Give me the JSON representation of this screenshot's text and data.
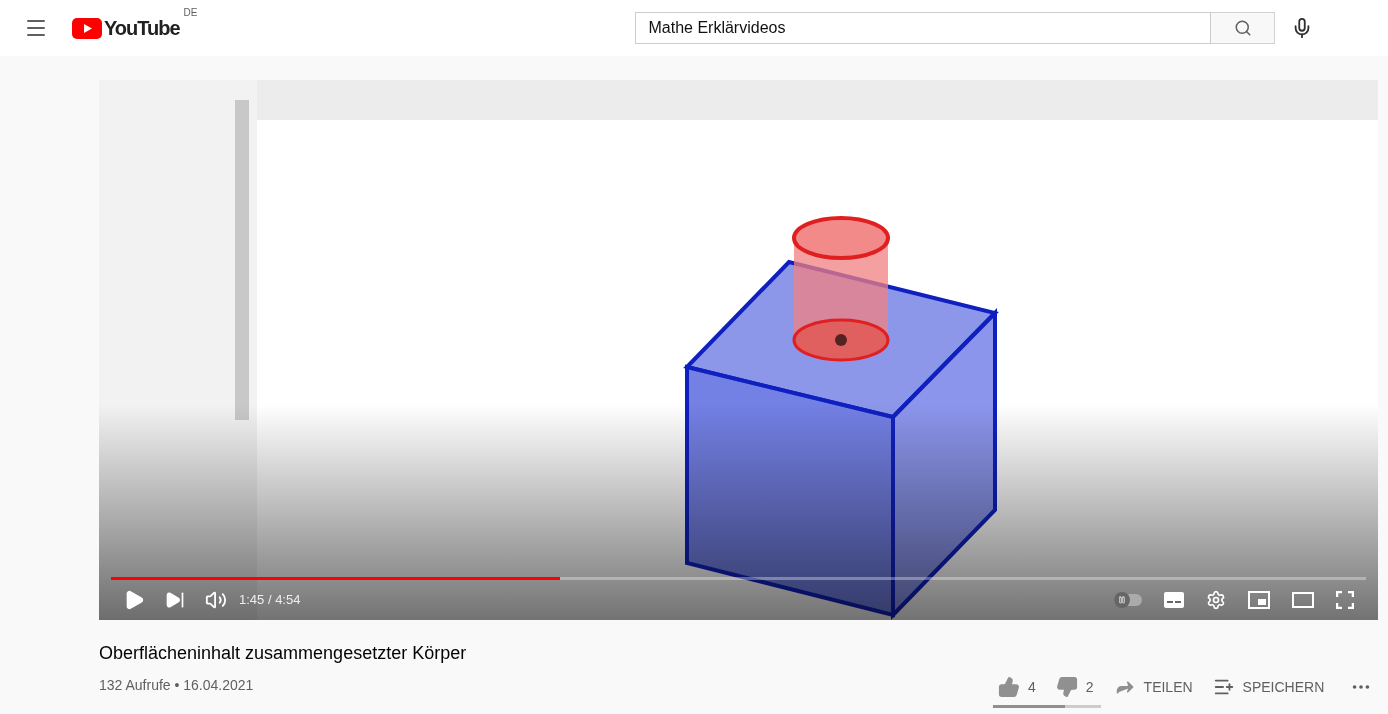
{
  "header": {
    "logo": "YouTube",
    "country": "DE",
    "search": {
      "value": "Mathe Erklärvideos"
    }
  },
  "player": {
    "progress": {
      "level": 0.358
    },
    "time": "1:45 / 4:54",
    "autoplay": {
      "on": false
    }
  },
  "video": {
    "title": "Oberflächeninhalt zusammengesetzter Körper",
    "meta": "132 Aufrufe • 16.04.2021"
  },
  "actions": {
    "likes": "4",
    "dislikes": "2",
    "share": "TEILEN",
    "save": "SPEICHERN",
    "rating": {
      "level": 0.667
    }
  }
}
